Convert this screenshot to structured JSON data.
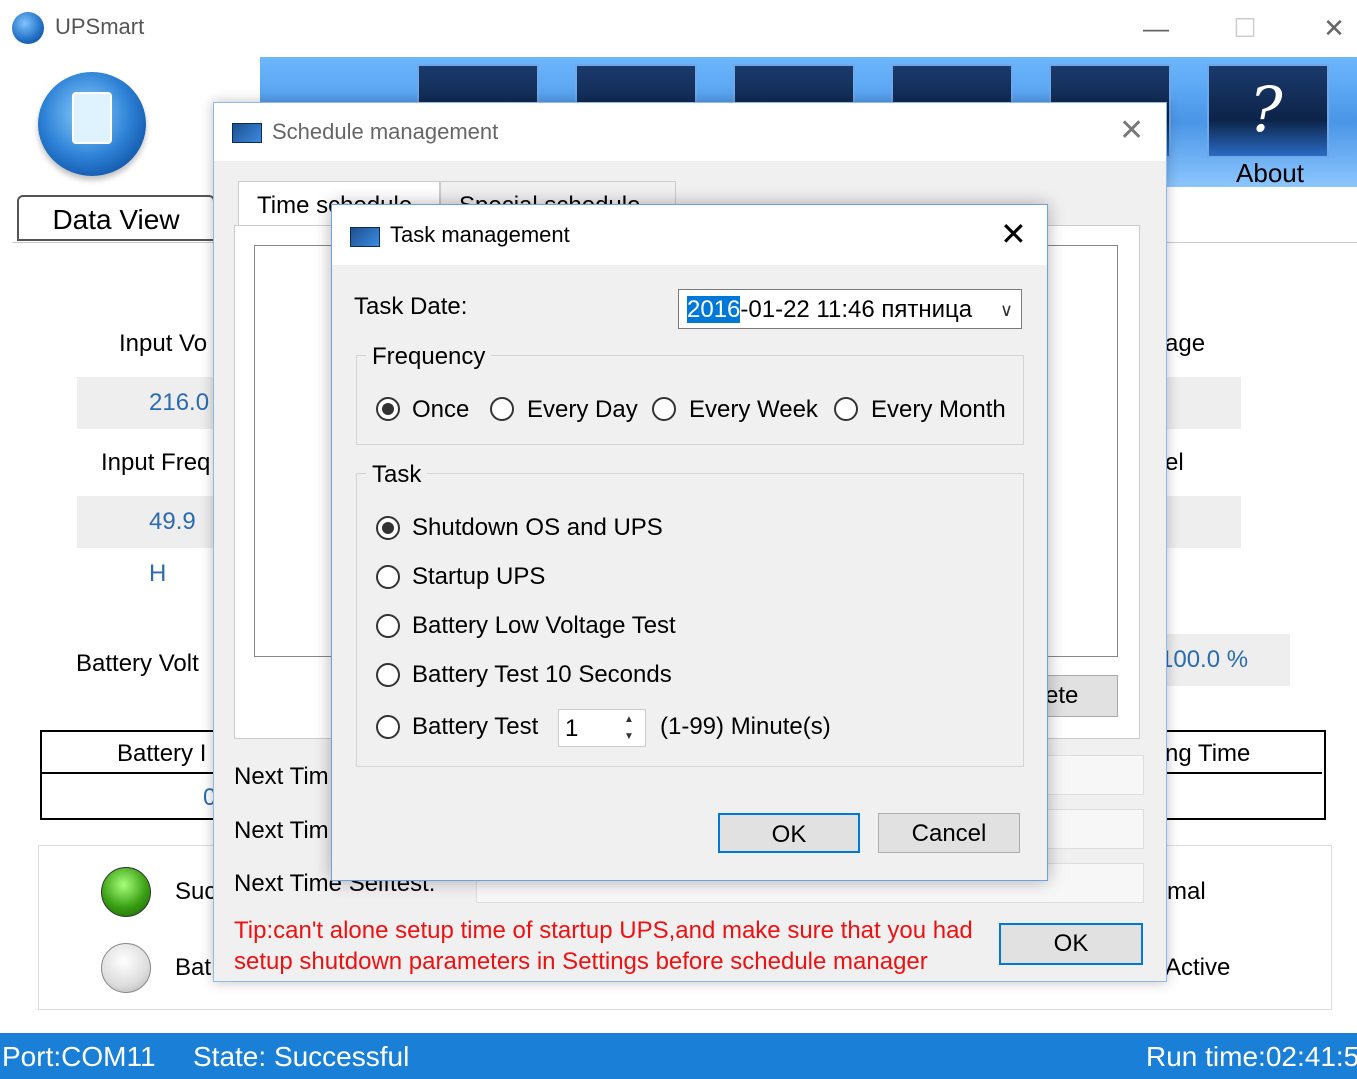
{
  "app": {
    "title": "UPSmart"
  },
  "window_controls": {
    "minimize": "—",
    "maximize": "☐",
    "close": "✕"
  },
  "toolbar": {
    "about_label": "About",
    "about_icon": "?"
  },
  "main_tab": {
    "label": "Data View"
  },
  "main": {
    "input_voltage_label": "Input Vo",
    "input_voltage_value": "216.0",
    "input_freq_label": "Input Freq",
    "input_freq_value": "49.9 H",
    "battery_volt_label": "Battery Volt",
    "right_voltage_label": "age",
    "right_level_label": "el",
    "battery_capacity_value": "100.0 %",
    "battery_header_left": "Battery I",
    "battery_header_right": "ng Time",
    "battery_value_left": "0",
    "status_success": "Suc",
    "status_battery": "Bat",
    "status_normal": "mal",
    "status_active": "Active"
  },
  "statusbar": {
    "port": "Port:COM11",
    "state": "State: Successful",
    "runtime": "Run time:02:41:5"
  },
  "schedule_dialog": {
    "title": "Schedule management",
    "tabs": [
      "Time schedule",
      "Special schedule"
    ],
    "delete_label": "ete",
    "next_time_1": "Next Tim",
    "next_time_2": "Next Tim",
    "next_time_selftest": "Next Time Selftest:",
    "tip": "Tip:can't alone setup time of startup UPS,and make sure that you had setup shutdown parameters in Settings before schedule manager",
    "ok_label": "OK"
  },
  "task_dialog": {
    "title": "Task management",
    "date_label": "Task Date:",
    "date_selected": "2016",
    "date_rest": "-01-22 11:46 пятница",
    "frequency_title": "Frequency",
    "frequency_options": [
      "Once",
      "Every Day",
      "Every Week",
      "Every Month"
    ],
    "frequency_selected": "Once",
    "task_title": "Task",
    "task_options": [
      "Shutdown OS and UPS",
      "Startup UPS",
      "Battery Low Voltage Test",
      "Battery Test 10 Seconds",
      "Battery Test"
    ],
    "task_selected": "Shutdown OS and UPS",
    "battery_test_minutes": "1",
    "minutes_hint": "(1-99) Minute(s)",
    "ok_label": "OK",
    "cancel_label": "Cancel"
  }
}
